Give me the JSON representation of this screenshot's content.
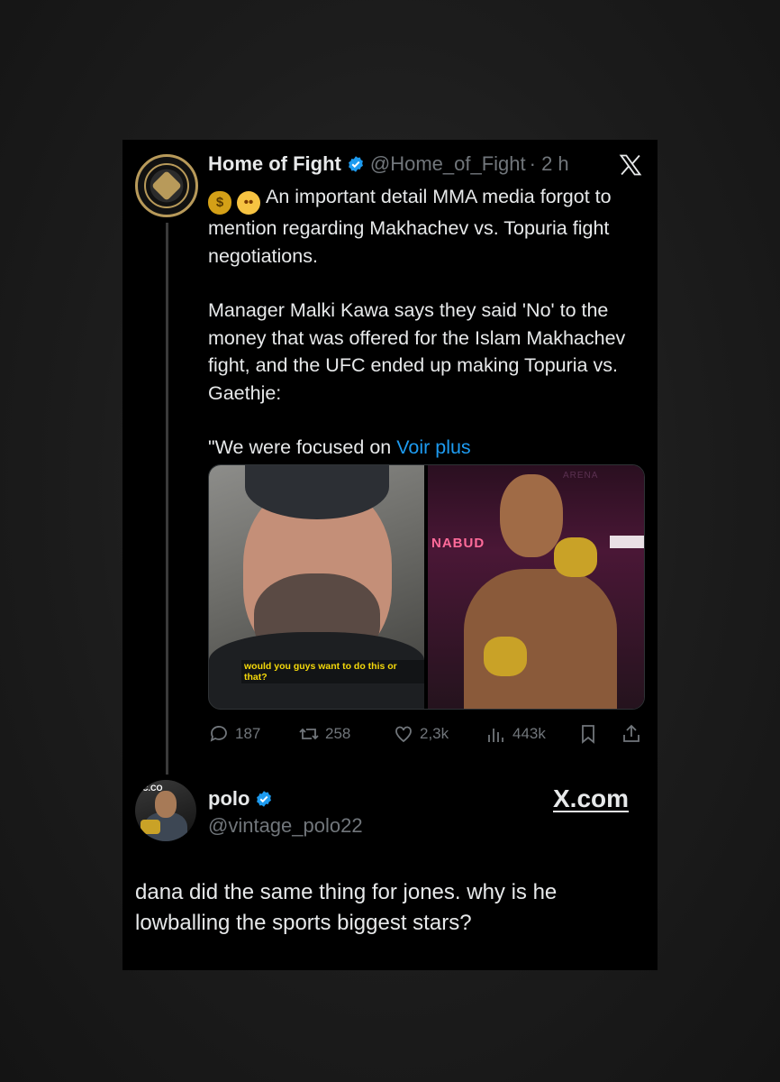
{
  "tweet": {
    "author_name": "Home of Fight",
    "author_handle": "@Home_of_Fight",
    "time": "· 2 h",
    "emoji_1": "money-bag",
    "emoji_2": "flushed-face",
    "paragraph_1": "An important detail MMA media forgot to mention regarding Makhachev vs. Topuria fight negotiations.",
    "paragraph_2": "Manager Malki Kawa says they said 'No' to the money that was offered for the Islam Makhachev fight, and the UFC ended up making Topuria vs. Gaethje:",
    "paragraph_3": "\"We were focused on",
    "see_more": "Voir plus",
    "media_left_subtitle": "would you guys want to do this or that?",
    "media_right_banner": "NABUD",
    "media_right_arena": "ARENA",
    "replies": "187",
    "reposts": "258",
    "likes": "2,3k",
    "views": "443k"
  },
  "reply": {
    "author_name": "polo",
    "author_handle": "@vintage_polo22",
    "avatar_badge_text": "C.CO",
    "text": "dana did the same thing for jones. why is he lowballing the sports biggest stars?"
  },
  "watermark": "X.com",
  "colors": {
    "background": "#000000",
    "text": "#e7e9ea",
    "muted": "#71767b",
    "link": "#1d9bf0",
    "verified": "#1d9bf0"
  }
}
